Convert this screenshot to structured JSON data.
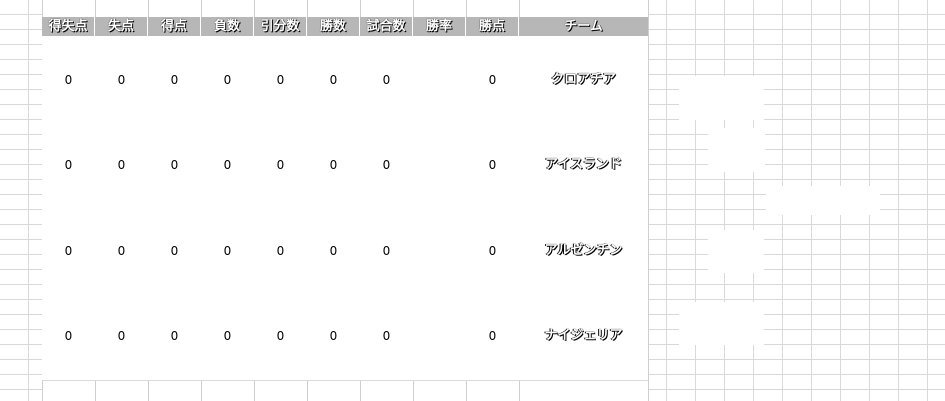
{
  "header": {
    "columns": [
      "得失点",
      "失点",
      "得点",
      "負数",
      "引分数",
      "勝数",
      "試合数",
      "勝率",
      "勝点"
    ],
    "team_label": "チーム"
  },
  "rows": [
    {
      "values": [
        "0",
        "0",
        "0",
        "0",
        "0",
        "0",
        "0",
        "",
        "0"
      ],
      "team": "クロアチア"
    },
    {
      "values": [
        "0",
        "0",
        "0",
        "0",
        "0",
        "0",
        "0",
        "",
        "0"
      ],
      "team": "アイスランド"
    },
    {
      "values": [
        "0",
        "0",
        "0",
        "0",
        "0",
        "0",
        "0",
        "",
        "0"
      ],
      "team": "アルゼンチン"
    },
    {
      "values": [
        "0",
        "0",
        "0",
        "0",
        "0",
        "0",
        "0",
        "",
        "0"
      ],
      "team": "ナイジェリア"
    }
  ],
  "colors": {
    "header_bg": "#b7b7b7",
    "grid": "#d9d9d9"
  }
}
